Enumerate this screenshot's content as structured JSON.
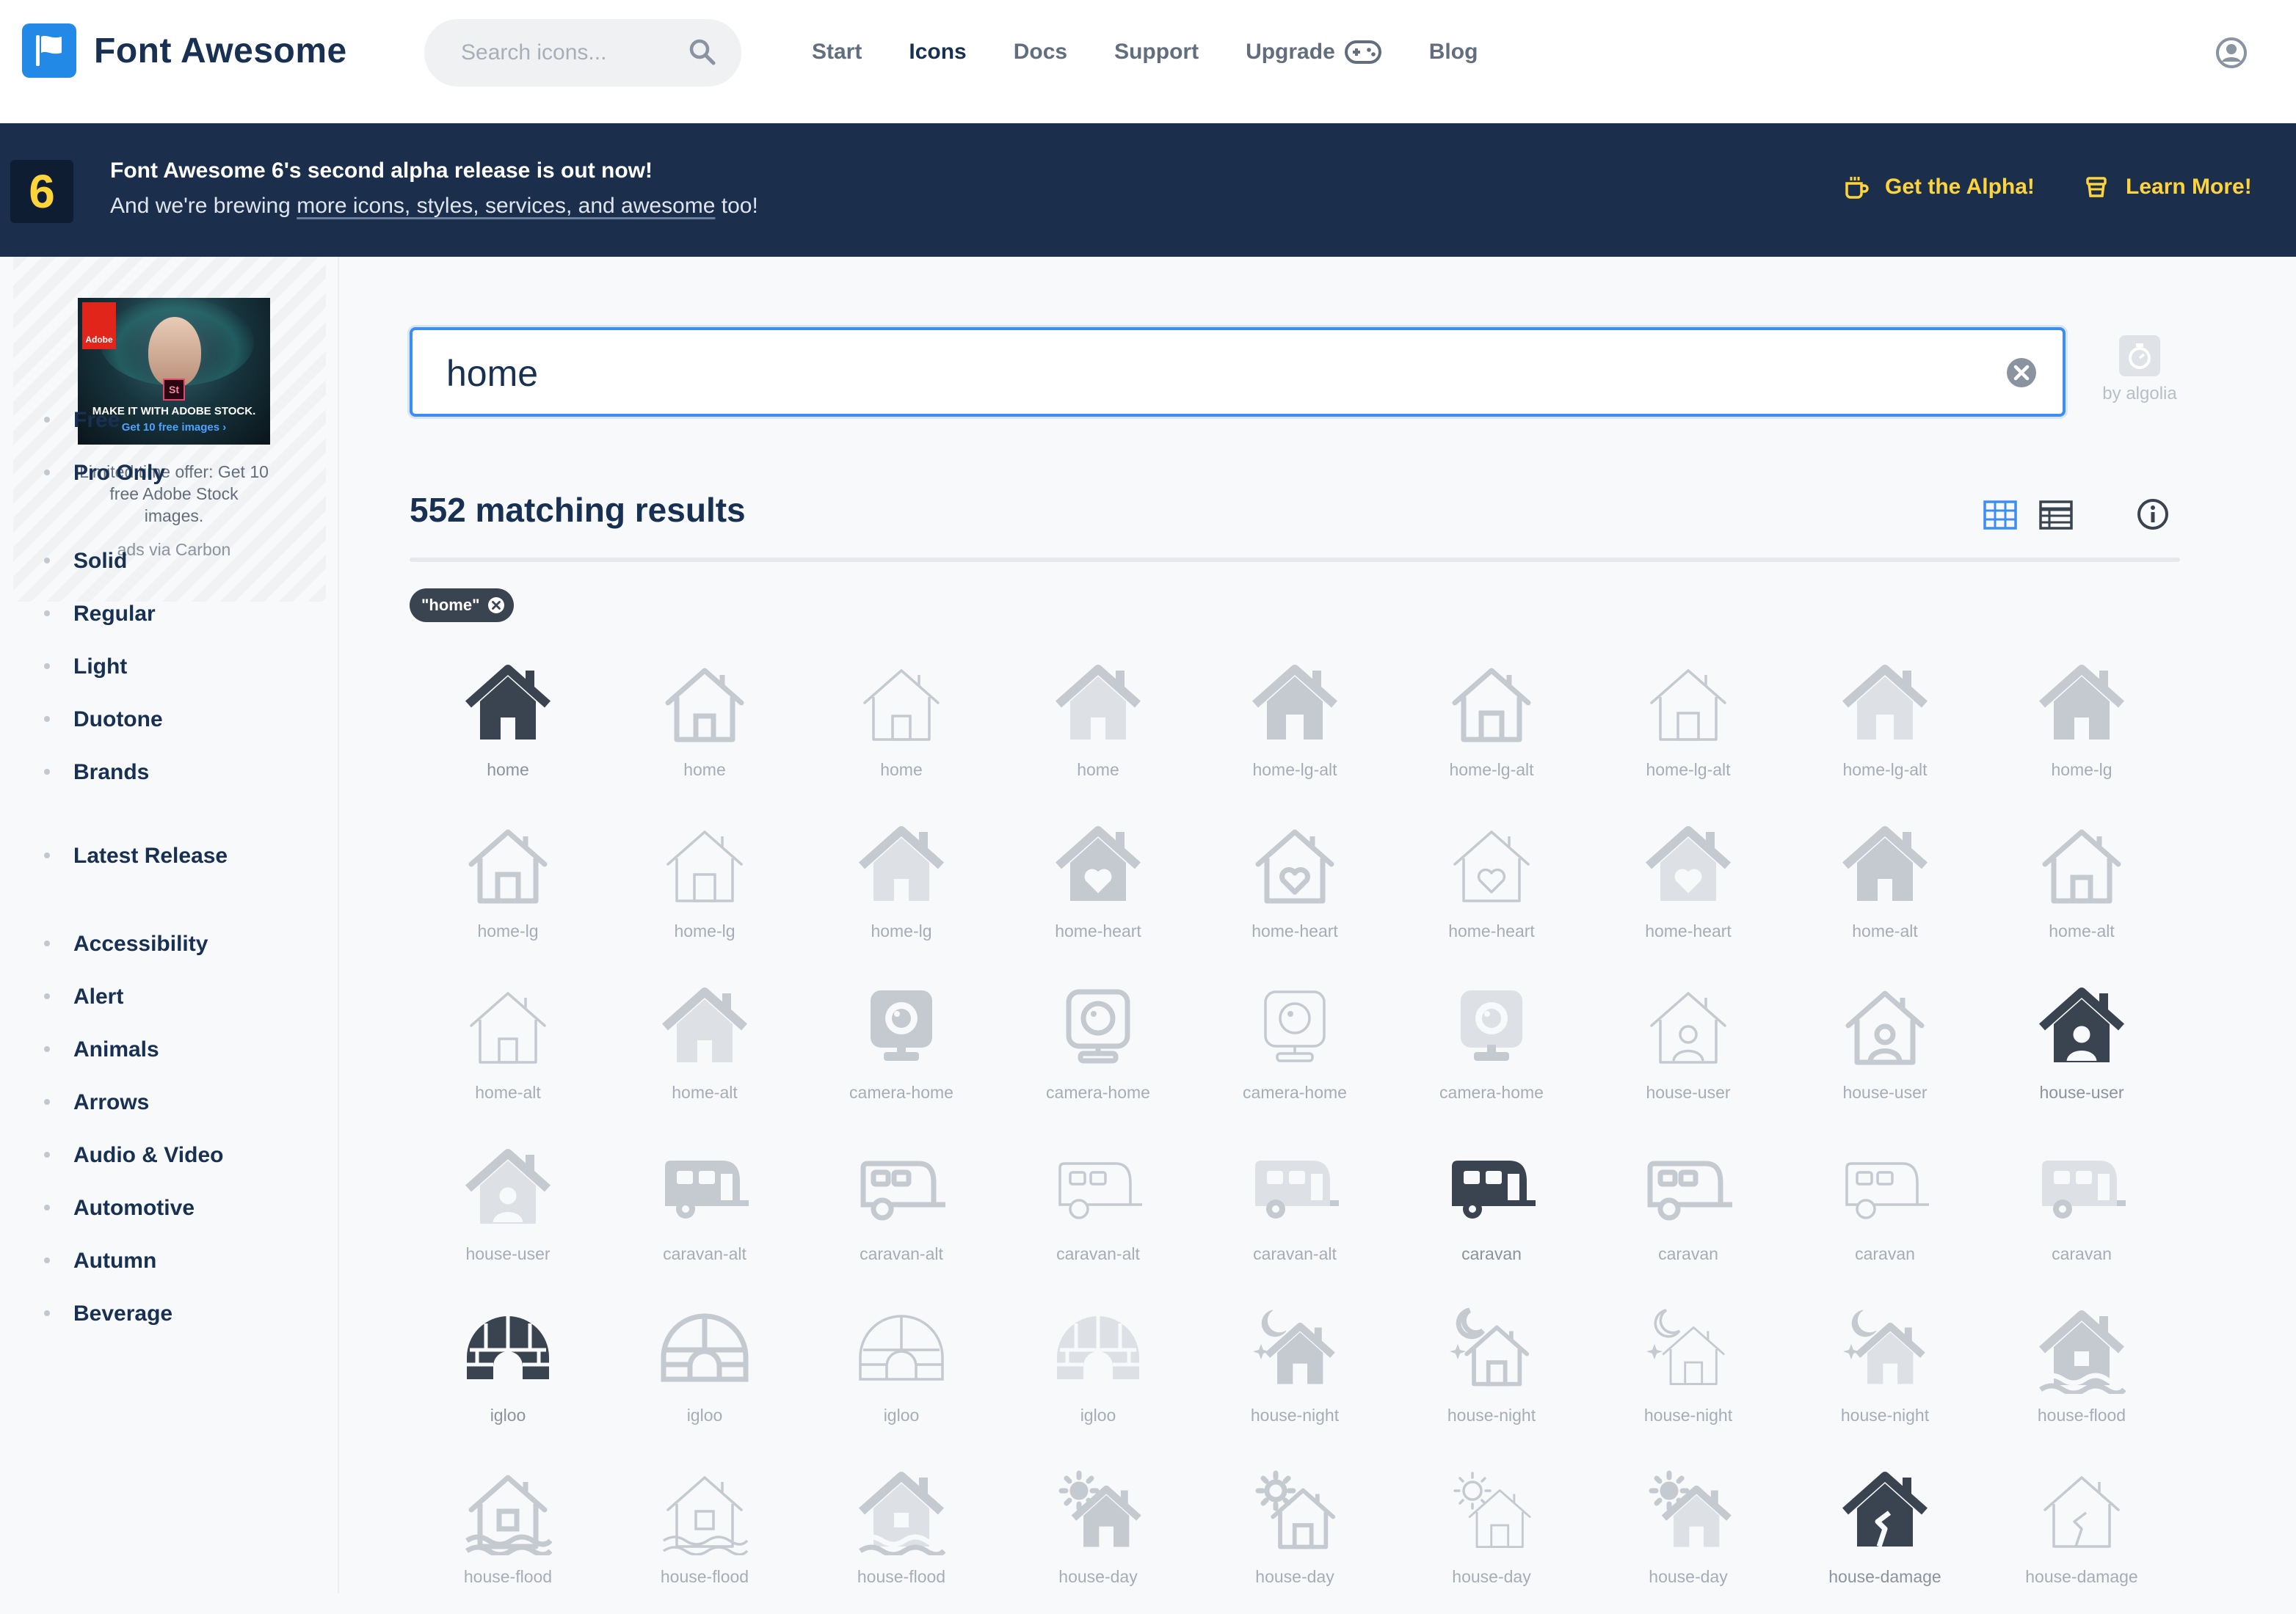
{
  "header": {
    "brand": "Font Awesome",
    "search_placeholder": "Search icons...",
    "nav": [
      {
        "label": "Start",
        "active": false
      },
      {
        "label": "Icons",
        "active": true
      },
      {
        "label": "Docs",
        "active": false
      },
      {
        "label": "Support",
        "active": false
      },
      {
        "label": "Upgrade",
        "active": false
      },
      {
        "label": "Blog",
        "active": false
      }
    ]
  },
  "banner": {
    "badge": "6",
    "line1": "Font Awesome 6's second alpha release is out now!",
    "line2_pre": "And we're brewing ",
    "line2_link": "more icons, styles, services, and awesome",
    "line2_post": " too!",
    "cta1": "Get the Alpha!",
    "cta2": "Learn More!",
    "accent": "#ffd43b",
    "background": "#1b2f4d"
  },
  "ad": {
    "brand": "Adobe",
    "product_badge": "St",
    "image_caption": "MAKE IT WITH ADOBE STOCK.",
    "image_subcaption": "Get 10 free images ›",
    "text": "Limited time offer: Get 10 free Adobe Stock images.",
    "via": "ads via Carbon"
  },
  "filters": {
    "membership": [
      "Free",
      "Pro Only"
    ],
    "styles": [
      "Solid",
      "Regular",
      "Light",
      "Duotone",
      "Brands"
    ],
    "release": [
      "Latest Release"
    ],
    "categories": [
      "Accessibility",
      "Alert",
      "Animals",
      "Arrows",
      "Audio & Video",
      "Automotive",
      "Autumn",
      "Beverage"
    ]
  },
  "search": {
    "value": "home",
    "powered_by": "by algolia"
  },
  "results": {
    "count_label": "552 matching results",
    "chip": "\"home\""
  },
  "colors": {
    "primary": "#183153",
    "focus": "#3d8ef0",
    "brand_blue": "#228ae6",
    "icon_dark": "#3a4350",
    "icon_light": "#c5cad1"
  },
  "icons": [
    {
      "label": "home",
      "shape": "home",
      "style": "solid",
      "tone": "dark"
    },
    {
      "label": "home",
      "shape": "home",
      "style": "outline",
      "tone": "light"
    },
    {
      "label": "home",
      "shape": "home",
      "style": "thin",
      "tone": "light"
    },
    {
      "label": "home",
      "shape": "home",
      "style": "duo",
      "tone": "light"
    },
    {
      "label": "home-lg-alt",
      "shape": "homelg",
      "style": "solid",
      "tone": "light"
    },
    {
      "label": "home-lg-alt",
      "shape": "homelg",
      "style": "outline",
      "tone": "light"
    },
    {
      "label": "home-lg-alt",
      "shape": "homelg",
      "style": "thin",
      "tone": "light"
    },
    {
      "label": "home-lg-alt",
      "shape": "homelg",
      "style": "duo",
      "tone": "light"
    },
    {
      "label": "home-lg",
      "shape": "home",
      "style": "solid",
      "tone": "light"
    },
    {
      "label": "home-lg",
      "shape": "homelg",
      "style": "outline",
      "tone": "light"
    },
    {
      "label": "home-lg",
      "shape": "homelg",
      "style": "thin",
      "tone": "light"
    },
    {
      "label": "home-lg",
      "shape": "home",
      "style": "duo",
      "tone": "light"
    },
    {
      "label": "home-heart",
      "shape": "heart",
      "style": "solid",
      "tone": "light"
    },
    {
      "label": "home-heart",
      "shape": "heart",
      "style": "outline",
      "tone": "light"
    },
    {
      "label": "home-heart",
      "shape": "heart",
      "style": "thin",
      "tone": "light"
    },
    {
      "label": "home-heart",
      "shape": "heart",
      "style": "duo",
      "tone": "light"
    },
    {
      "label": "home-alt",
      "shape": "home",
      "style": "solid",
      "tone": "light"
    },
    {
      "label": "home-alt",
      "shape": "home",
      "style": "outline",
      "tone": "light"
    },
    {
      "label": "home-alt",
      "shape": "home",
      "style": "thin",
      "tone": "light"
    },
    {
      "label": "home-alt",
      "shape": "home",
      "style": "duo",
      "tone": "light"
    },
    {
      "label": "camera-home",
      "shape": "camera",
      "style": "solid",
      "tone": "light"
    },
    {
      "label": "camera-home",
      "shape": "camera",
      "style": "outline",
      "tone": "light"
    },
    {
      "label": "camera-home",
      "shape": "camera",
      "style": "thin",
      "tone": "light"
    },
    {
      "label": "camera-home",
      "shape": "camera",
      "style": "duo",
      "tone": "light"
    },
    {
      "label": "house-user",
      "shape": "user",
      "style": "thin",
      "tone": "light"
    },
    {
      "label": "house-user",
      "shape": "user",
      "style": "outline",
      "tone": "light"
    },
    {
      "label": "house-user",
      "shape": "user",
      "style": "solid",
      "tone": "dark"
    },
    {
      "label": "house-user",
      "shape": "user",
      "style": "duo",
      "tone": "light"
    },
    {
      "label": "caravan-alt",
      "shape": "caravan",
      "style": "solid",
      "tone": "light"
    },
    {
      "label": "caravan-alt",
      "shape": "caravan",
      "style": "outline",
      "tone": "light"
    },
    {
      "label": "caravan-alt",
      "shape": "caravan",
      "style": "thin",
      "tone": "light"
    },
    {
      "label": "caravan-alt",
      "shape": "caravan",
      "style": "duo",
      "tone": "light"
    },
    {
      "label": "caravan",
      "shape": "caravan",
      "style": "solid",
      "tone": "dark"
    },
    {
      "label": "caravan",
      "shape": "caravan",
      "style": "outline",
      "tone": "light"
    },
    {
      "label": "caravan",
      "shape": "caravan",
      "style": "thin",
      "tone": "light"
    },
    {
      "label": "caravan",
      "shape": "caravan",
      "style": "duo",
      "tone": "light"
    },
    {
      "label": "igloo",
      "shape": "igloo",
      "style": "solid",
      "tone": "dark"
    },
    {
      "label": "igloo",
      "shape": "igloo",
      "style": "outline",
      "tone": "light"
    },
    {
      "label": "igloo",
      "shape": "igloo",
      "style": "thin",
      "tone": "light"
    },
    {
      "label": "igloo",
      "shape": "igloo",
      "style": "duo",
      "tone": "light"
    },
    {
      "label": "house-night",
      "shape": "night",
      "style": "solid",
      "tone": "light"
    },
    {
      "label": "house-night",
      "shape": "night",
      "style": "outline",
      "tone": "light"
    },
    {
      "label": "house-night",
      "shape": "night",
      "style": "thin",
      "tone": "light"
    },
    {
      "label": "house-night",
      "shape": "night",
      "style": "duo",
      "tone": "light"
    },
    {
      "label": "house-flood",
      "shape": "flood",
      "style": "solid",
      "tone": "light"
    },
    {
      "label": "house-flood",
      "shape": "flood",
      "style": "outline",
      "tone": "light"
    },
    {
      "label": "house-flood",
      "shape": "flood",
      "style": "thin",
      "tone": "light"
    },
    {
      "label": "house-flood",
      "shape": "flood",
      "style": "duo",
      "tone": "light"
    },
    {
      "label": "house-day",
      "shape": "day",
      "style": "solid",
      "tone": "light"
    },
    {
      "label": "house-day",
      "shape": "day",
      "style": "outline",
      "tone": "light"
    },
    {
      "label": "house-day",
      "shape": "day",
      "style": "thin",
      "tone": "light"
    },
    {
      "label": "house-day",
      "shape": "day",
      "style": "duo",
      "tone": "light"
    },
    {
      "label": "house-damage",
      "shape": "damage",
      "style": "solid",
      "tone": "dark"
    },
    {
      "label": "house-damage",
      "shape": "damage",
      "style": "thin",
      "tone": "light"
    }
  ]
}
